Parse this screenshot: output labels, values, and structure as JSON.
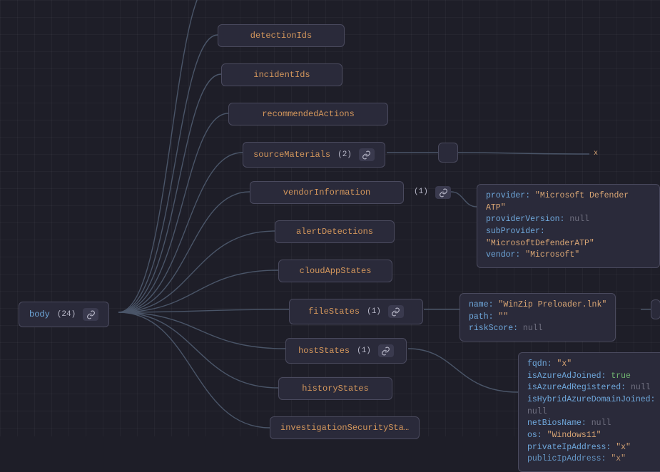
{
  "root": {
    "label": "body",
    "count": "(24)"
  },
  "children": [
    {
      "label": "detectionIds",
      "count": null,
      "hasLink": false
    },
    {
      "label": "incidentIds",
      "count": null,
      "hasLink": false
    },
    {
      "label": "recommendedActions",
      "count": null,
      "hasLink": false
    },
    {
      "label": "sourceMaterials",
      "count": "(2)",
      "hasLink": true
    },
    {
      "label": "vendorInformation",
      "count": null,
      "hasLink": false,
      "external": true,
      "extCount": "(1)"
    },
    {
      "label": "alertDetections",
      "count": null,
      "hasLink": false
    },
    {
      "label": "cloudAppStates",
      "count": null,
      "hasLink": false
    },
    {
      "label": "fileStates",
      "count": "(1)",
      "hasLink": true
    },
    {
      "label": "hostStates",
      "count": "(1)",
      "hasLink": true
    },
    {
      "label": "historyStates",
      "count": null,
      "hasLink": false
    },
    {
      "label": "investigationSecuritySta…",
      "count": null,
      "hasLink": false
    }
  ],
  "vendorInformation": {
    "provider": "\"Microsoft Defender ATP\"",
    "providerVersion": "null",
    "subProvider": "\"MicrosoftDefenderATP\"",
    "vendor": "\"Microsoft\""
  },
  "fileState": {
    "name": "\"WinZip Preloader.lnk\"",
    "path": "\"\"",
    "riskScore": "null"
  },
  "hostState": {
    "fqdn": "\"x\"",
    "isAzureAdJoined": "true",
    "isAzureAdRegistered": "null",
    "isHybridAzureDomainJoined": "null",
    "netBiosName": "null",
    "os": "\"Windows11\"",
    "privateIpAddress": "\"x\"",
    "publicIpAddress": "\"x\""
  },
  "xMark": "x"
}
